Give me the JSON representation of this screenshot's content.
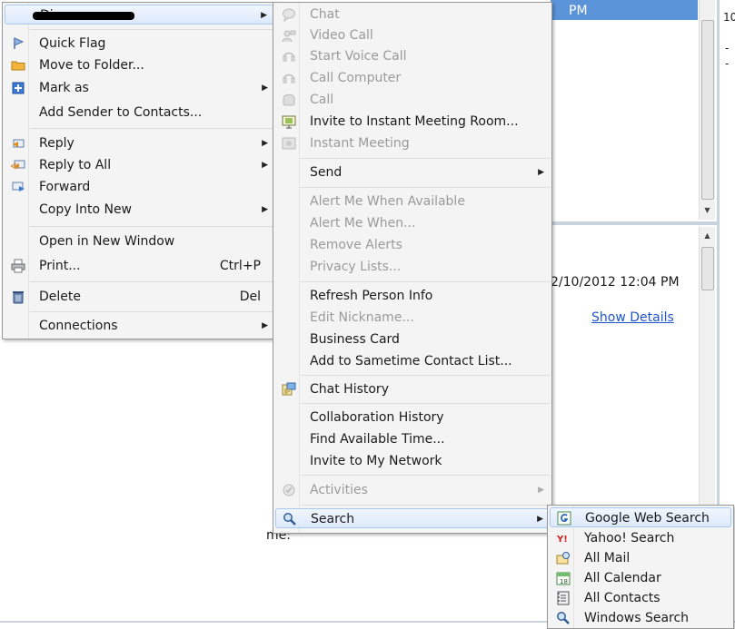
{
  "background": {
    "header_text": "PM",
    "date_text": "2/10/2012 12:04 PM",
    "show_details": "Show Details",
    "snippet_me": "me:"
  },
  "menu_main": {
    "top_item": "Di",
    "items": [
      {
        "label": "Quick Flag",
        "icon": "flag-icon"
      },
      {
        "label": "Move to Folder...",
        "icon": "folder-icon"
      },
      {
        "label": "Mark as",
        "icon": "mark-icon",
        "submenu": true
      },
      {
        "label": "Add Sender to Contacts..."
      },
      {
        "label": "Reply",
        "icon": "reply-icon",
        "submenu": true
      },
      {
        "label": "Reply to All",
        "icon": "reply-all-icon",
        "submenu": true
      },
      {
        "label": "Forward",
        "icon": "forward-icon"
      },
      {
        "label": "Copy Into New",
        "submenu": true
      },
      {
        "label": "Open in New Window"
      },
      {
        "label": "Print...",
        "icon": "printer-icon",
        "shortcut": "Ctrl+P"
      },
      {
        "label": "Delete",
        "icon": "trash-icon",
        "shortcut": "Del"
      },
      {
        "label": "Connections",
        "submenu": true
      }
    ]
  },
  "menu_connections": {
    "items": [
      {
        "label": "Chat",
        "disabled": true
      },
      {
        "label": "Video Call",
        "disabled": true
      },
      {
        "label": "Start Voice Call",
        "disabled": true
      },
      {
        "label": "Call Computer",
        "disabled": true
      },
      {
        "label": "Call",
        "disabled": true
      },
      {
        "label": "Invite to Instant Meeting Room..."
      },
      {
        "label": "Instant Meeting",
        "disabled": true
      },
      {
        "label": "Send",
        "submenu": true
      },
      {
        "label": "Alert Me When Available",
        "disabled": true
      },
      {
        "label": "Alert Me When...",
        "disabled": true
      },
      {
        "label": "Remove Alerts",
        "disabled": true
      },
      {
        "label": "Privacy Lists...",
        "disabled": true
      },
      {
        "label": "Refresh Person Info"
      },
      {
        "label": "Edit Nickname...",
        "disabled": true
      },
      {
        "label": "Business Card"
      },
      {
        "label": "Add to Sametime Contact List..."
      },
      {
        "label": "Chat History"
      },
      {
        "label": "Collaboration History"
      },
      {
        "label": "Find Available Time..."
      },
      {
        "label": "Invite to My Network"
      },
      {
        "label": "Activities",
        "disabled": true,
        "submenu": true
      },
      {
        "label": "Search",
        "submenu": true,
        "highlighted": true
      }
    ]
  },
  "menu_search": {
    "items": [
      {
        "label": "Google Web Search",
        "highlighted": true
      },
      {
        "label": "Yahoo! Search"
      },
      {
        "label": "All Mail"
      },
      {
        "label": "All Calendar"
      },
      {
        "label": "All Contacts"
      },
      {
        "label": "Windows Search"
      }
    ]
  },
  "colors": {
    "menu_bg": "#f4f4f4",
    "highlight_border": "#a8c8ee",
    "header_blue": "#5b93d9",
    "link_blue": "#1f55c9"
  }
}
